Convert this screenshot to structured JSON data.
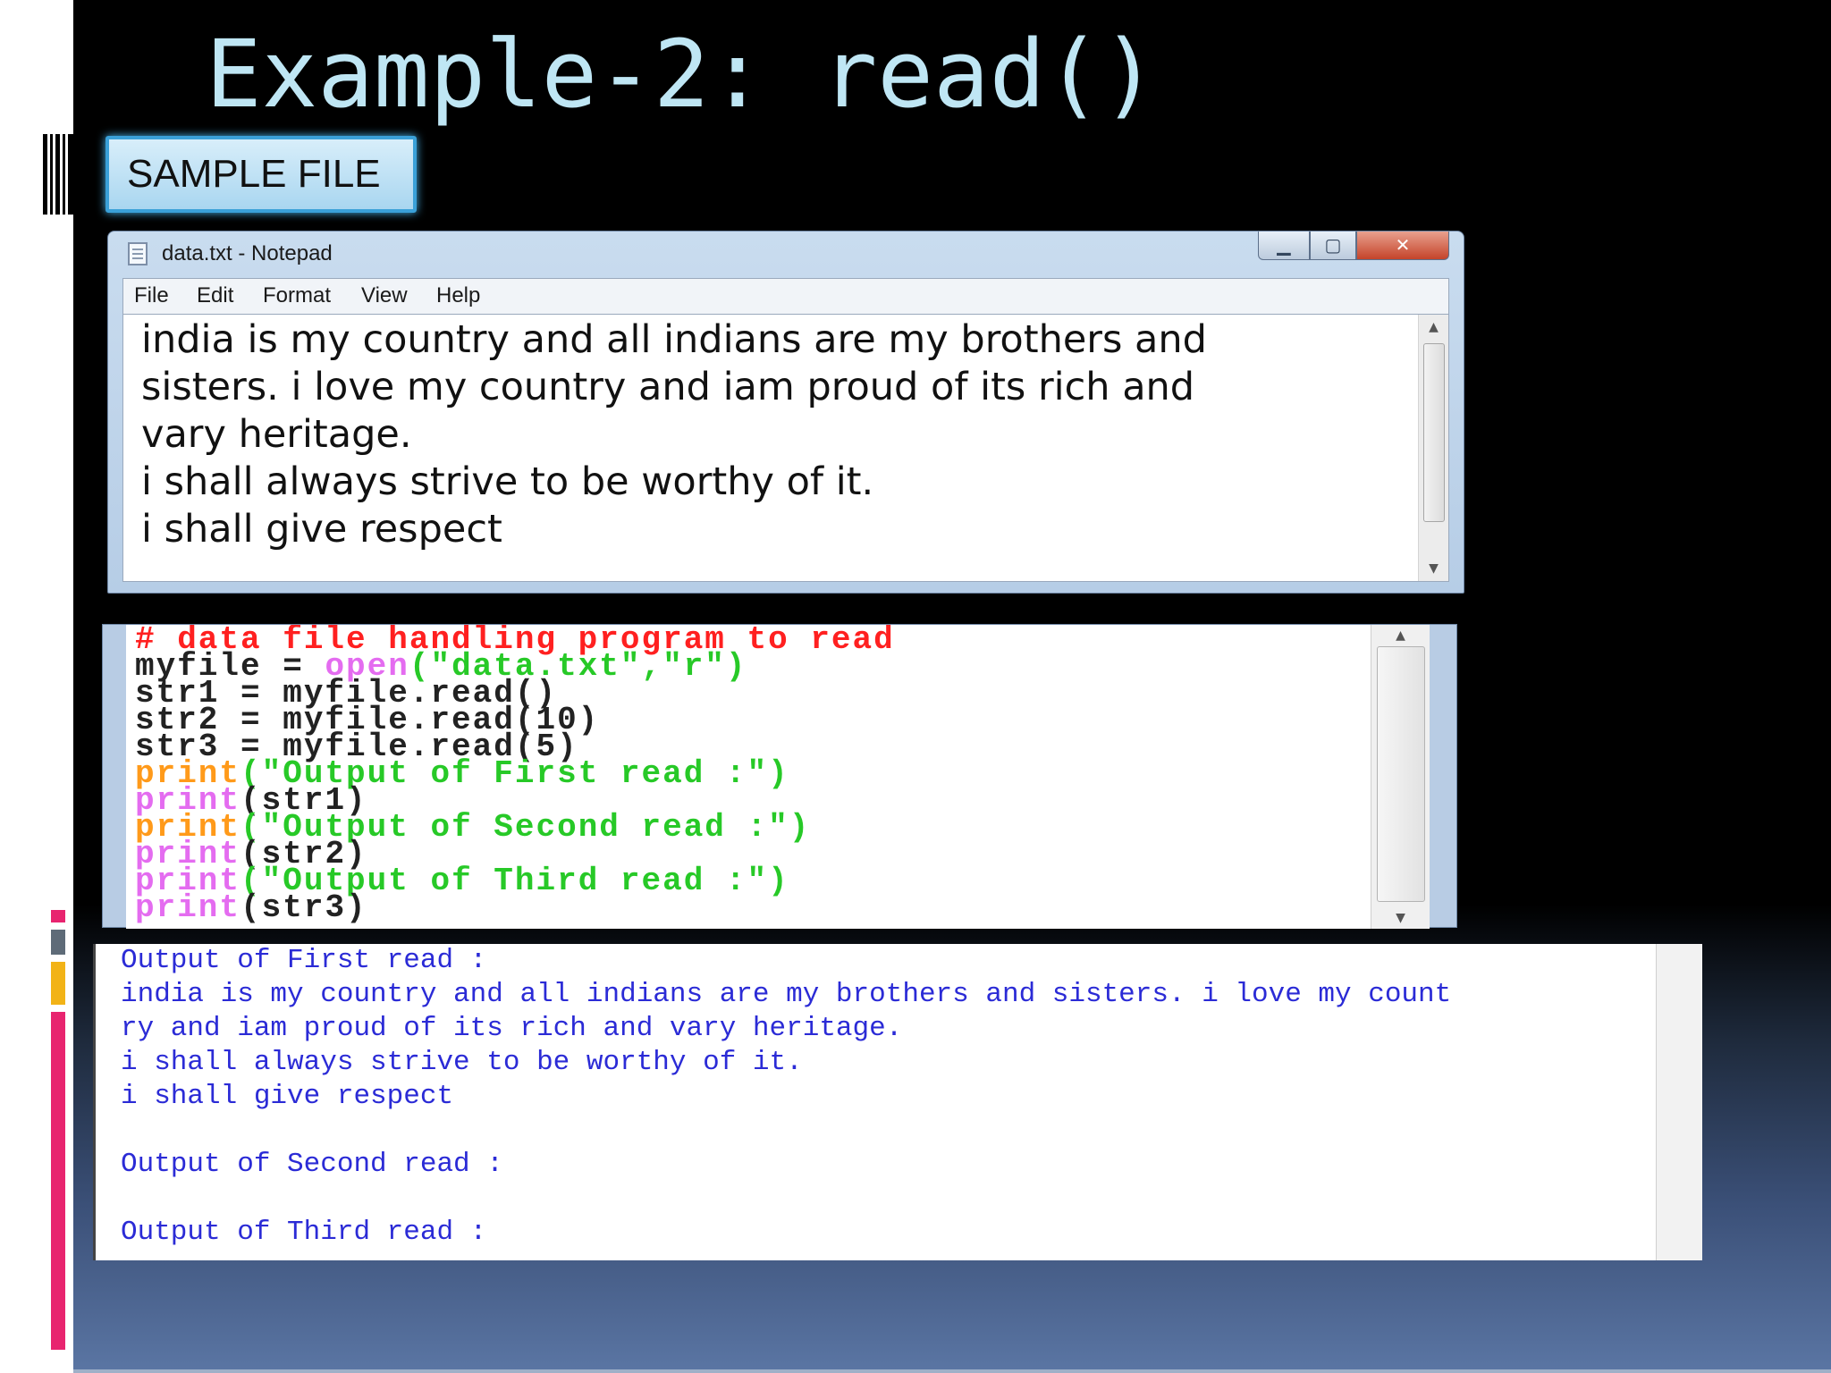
{
  "slide": {
    "title": "Example-2: read()",
    "sample_label": "SAMPLE FILE"
  },
  "colors": {
    "title": "#bfe6f4",
    "accent_pink": "#e8246f",
    "accent_gold": "#f2b317",
    "accent_gray": "#5e6b78",
    "code_comment": "#ff2020",
    "code_builtin": "#e46cf0",
    "code_print": "#ff9a1a",
    "code_string": "#27c927",
    "output_text": "#2b2bd6"
  },
  "notepad": {
    "title": "data.txt - Notepad",
    "menu": [
      "File",
      "Edit",
      "Format",
      "View",
      "Help"
    ],
    "lines": [
      "india is my country and all indians are my brothers and",
      "sisters. i love my country and iam proud of its rich and",
      "vary heritage.",
      "i shall always strive to be worthy of it.",
      "i shall give respect"
    ]
  },
  "code": {
    "line1": "# data file handling program to read",
    "line2_a": "myfile = ",
    "line2_b": "open",
    "line2_c": "(\"data.txt\",\"r\")",
    "line3": "str1 = myfile.read()",
    "line4": "str2 = myfile.read(10)",
    "line5": "str3 = myfile.read(5)",
    "print_kw": "print",
    "line6_arg": "(\"Output of First read :\")",
    "line7_arg": "(str1)",
    "line8_arg": "(\"Output of Second read :\")",
    "line9_arg": "(str2)",
    "line10_arg": "(\"Output of Third read :\")",
    "line11_arg": "(str3)"
  },
  "output": {
    "lines": [
      "Output of First read :",
      "india is my country and all indians are my brothers and sisters. i love my count",
      "ry and iam proud of its rich and vary heritage.",
      "i shall always strive to be worthy of it.",
      "i shall give respect",
      "",
      "Output of Second read :",
      "",
      "Output of Third read :"
    ]
  }
}
